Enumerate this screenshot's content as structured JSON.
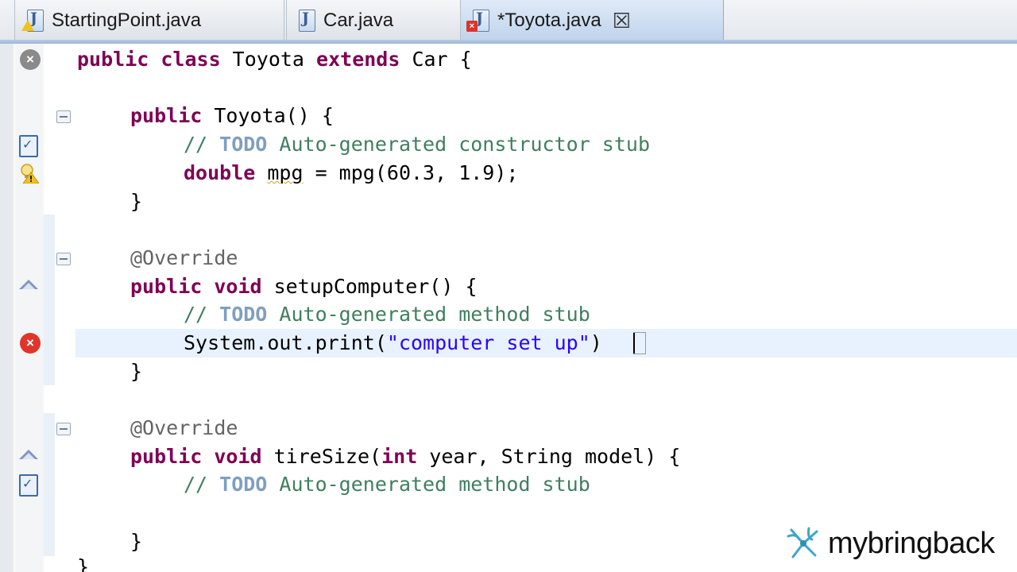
{
  "tabs": [
    {
      "label": "StartingPoint.java",
      "state": "inactive",
      "icon": "java-file-warning-icon"
    },
    {
      "label": "Car.java",
      "state": "inactive",
      "icon": "java-file-icon"
    },
    {
      "label": "*Toyota.java",
      "state": "active",
      "icon": "java-file-error-icon",
      "close": "☒"
    }
  ],
  "code": {
    "line1": {
      "kw": "public class",
      "a": " Toyota ",
      "kw2": "extends",
      "b": " Car {"
    },
    "line4": {
      "kw": "public",
      "a": " Toyota() {"
    },
    "line5": {
      "a": "// ",
      "todo": "TODO",
      "b": " Auto-generated constructor stub"
    },
    "line6": {
      "kw": "double",
      "sp": " ",
      "var": "mpg",
      "b": " = mpg(60.3, 1.9);"
    },
    "line7": "}",
    "line9": "@Override",
    "line10": {
      "kw": "public void",
      "a": " setupComputer() {"
    },
    "line11": {
      "a": "// ",
      "todo": "TODO",
      "b": " Auto-generated method stub"
    },
    "line12": {
      "a": "System.out.print(",
      "str": "\"computer set up\"",
      "b": ")"
    },
    "line13": "}",
    "line15": "@Override",
    "line16": {
      "kw": "public void",
      "a": " tireSize(",
      "kw2": "int",
      "b": " year, String model) {"
    },
    "line17": {
      "a": "// ",
      "todo": "TODO",
      "b": " Auto-generated method stub"
    },
    "line19": "}",
    "line20": "}"
  },
  "brand": {
    "text": "mybringback",
    "logo": "mybringback-logo-icon"
  },
  "colors": {
    "keyword": "#7f0055",
    "comment": "#3f7f5f",
    "todo": "#7f9fbf",
    "string": "#2a00ff",
    "current_line": "#e8f2fe",
    "error": "#e0352b"
  }
}
